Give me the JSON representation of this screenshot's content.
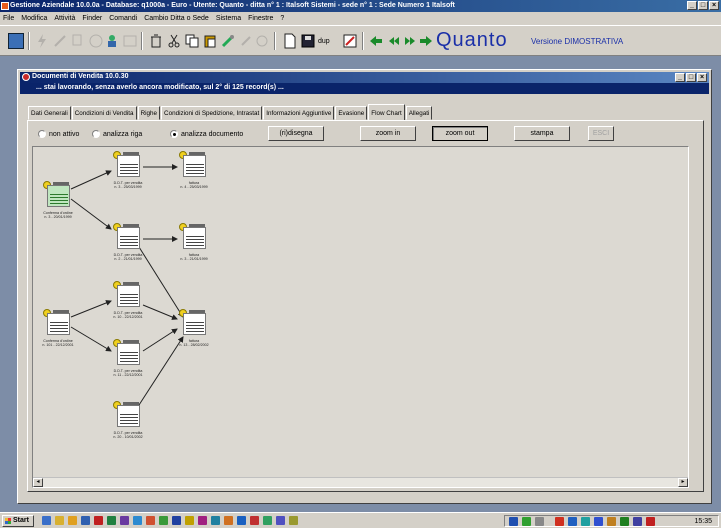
{
  "window": {
    "title": "Gestione Aziendale 10.0.0a - Database: q1000a - Euro - Utente: Quanto - ditta n° 1 : Italsoft Sistemi - sede n° 1 : Sede Numero 1 Italsoft",
    "buttons": [
      "_",
      "□",
      "×"
    ]
  },
  "menu": [
    "File",
    "Modifica",
    "Attività",
    "Finder",
    "Comandi",
    "Cambio Ditta o Sede",
    "Sistema",
    "Finestre",
    "?"
  ],
  "toolbar": {
    "dup_label": "dup",
    "logo": "Quanto",
    "version": "Versione DIMOSTRATIVA"
  },
  "child": {
    "title": "Documenti di Vendita 10.0.30",
    "status": "... stai lavorando, senza averlo ancora modificato, sul 2° di 125 record(s) ...",
    "tabs": [
      "Dati Generali",
      "Condizioni di Vendita",
      "Righe",
      "Condizioni di Spedizione, Intrastat",
      "Informazioni Aggiuntive",
      "Evasione",
      "Flow Chart",
      "Allegati"
    ],
    "active_tab": "Flow Chart"
  },
  "flow": {
    "modes": [
      "non attivo",
      "analizza riga",
      "analizza documento"
    ],
    "selected_mode": "analizza documento",
    "buttons": {
      "redraw": "(ri)disegna",
      "zoom_in": "zoom in",
      "zoom_out": "zoom out",
      "print": "stampa",
      "disabled": "ESCI"
    },
    "nodes": [
      {
        "id": "n1",
        "l1": "Conferma d'ordine",
        "l2": "n. 3 - 20/01/1999",
        "green": true
      },
      {
        "id": "n2",
        "l1": "D.D.T. per vendita",
        "l2": "n. 3 - 25/03/1999",
        "green": false
      },
      {
        "id": "n3",
        "l1": "fattura",
        "l2": "n. 4 - 25/03/1999",
        "green": false
      },
      {
        "id": "n4",
        "l1": "D.D.T. per vendita",
        "l2": "n. 2 - 21/01/1999",
        "green": false
      },
      {
        "id": "n5",
        "l1": "fattura",
        "l2": "n. 3 - 21/01/1999",
        "green": false
      },
      {
        "id": "n6",
        "l1": "Conferma d'ordine",
        "l2": "n. 101 - 22/12/2001",
        "green": false
      },
      {
        "id": "n7",
        "l1": "D.D.T. per vendita",
        "l2": "n. 10 - 22/12/2001",
        "green": false
      },
      {
        "id": "n8",
        "l1": "fattura",
        "l2": "n. 13 - 28/02/2002",
        "green": false
      },
      {
        "id": "n9",
        "l1": "D.D.T. per vendita",
        "l2": "n. 11 - 22/12/2001",
        "green": false
      },
      {
        "id": "n10",
        "l1": "D.D.T. per vendita",
        "l2": "n. 20 - 10/01/2002",
        "green": false
      }
    ]
  },
  "taskbar": {
    "start": "Start",
    "clock": "15:35"
  }
}
